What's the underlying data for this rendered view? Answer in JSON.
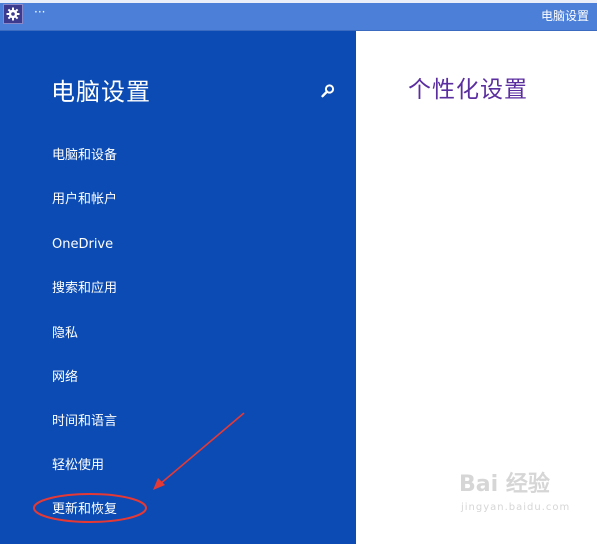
{
  "window": {
    "title": "电脑设置",
    "menu_label": "···"
  },
  "sidebar": {
    "title": "电脑设置",
    "search_icon": "search-icon",
    "items": [
      {
        "label": "电脑和设备"
      },
      {
        "label": "用户和帐户"
      },
      {
        "label": "OneDrive"
      },
      {
        "label": "搜索和应用"
      },
      {
        "label": "隐私"
      },
      {
        "label": "网络"
      },
      {
        "label": "时间和语言"
      },
      {
        "label": "轻松使用"
      },
      {
        "label": "更新和恢复"
      }
    ]
  },
  "main": {
    "title": "个性化设置"
  },
  "annotation": {
    "highlighted_item": "更新和恢复",
    "color": "#e53935"
  },
  "watermark": {
    "main": "Bai 经验",
    "sub": "jingyan.baidu.com"
  },
  "colors": {
    "titlebar": "#4b7fd8",
    "sidebar": "#0b4bb3",
    "main_title": "#5b2ea0"
  }
}
